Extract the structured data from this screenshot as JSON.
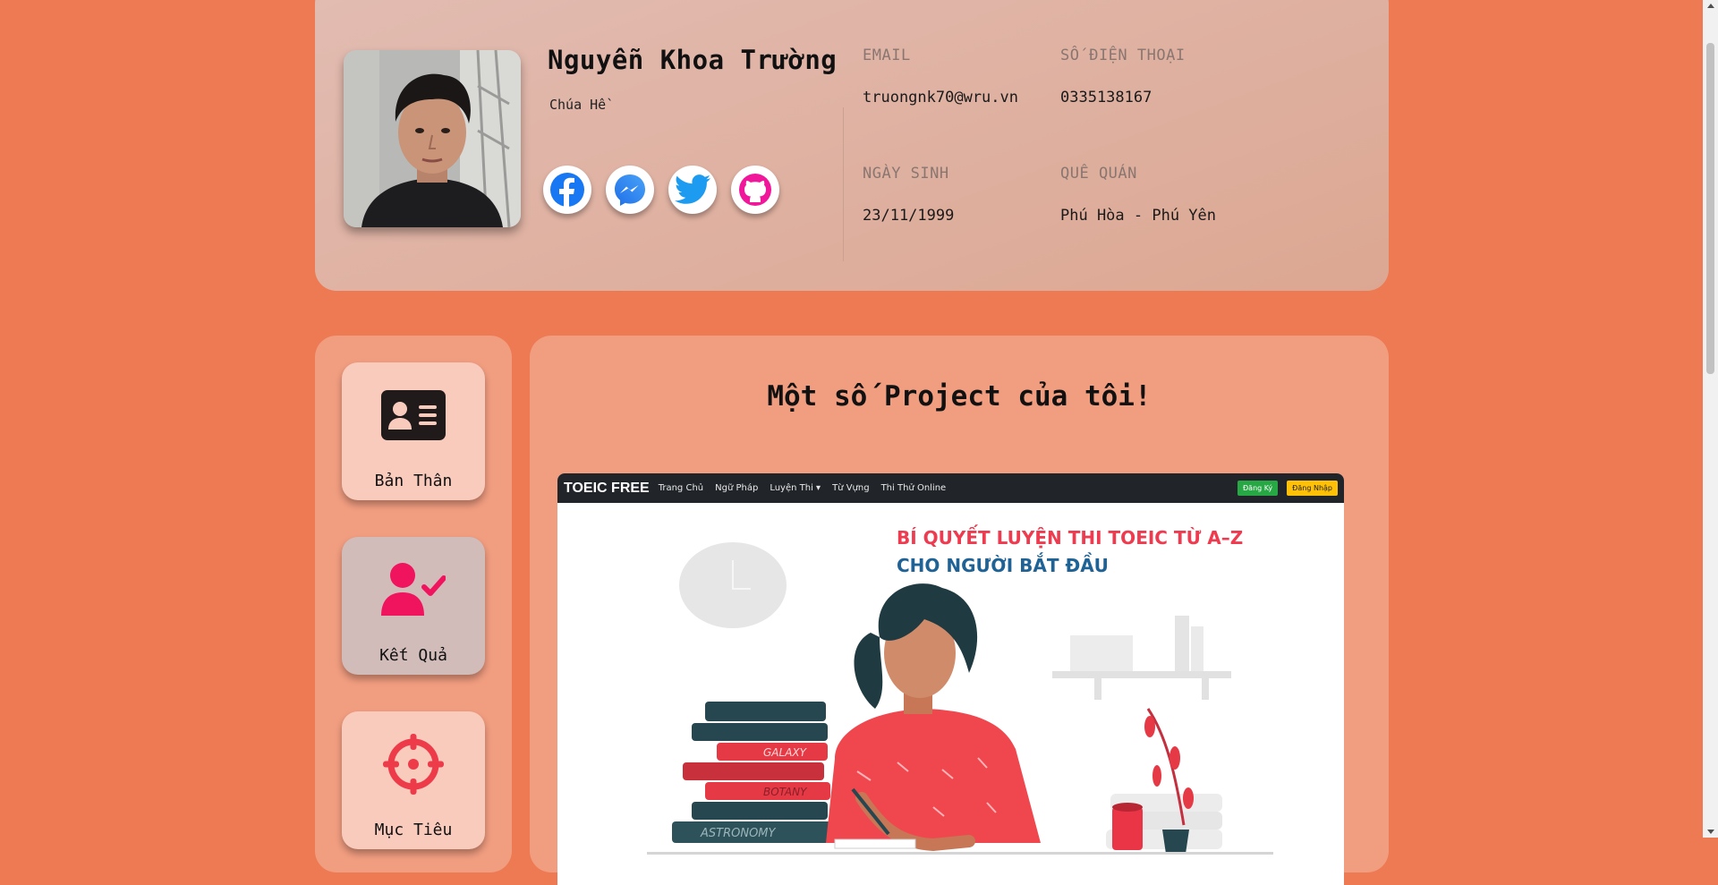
{
  "profile": {
    "name": "Nguyễn Khoa Trường",
    "subtitle": "Chúa Hề",
    "email_label": "EMAIL",
    "email": "truongnk70@wru.vn",
    "phone_label": "SỐ ĐIỆN THOẠI",
    "phone": "0335138167",
    "birthday_label": "NGÀY SINH",
    "birthday": "23/11/1999",
    "hometown_label": "QUÊ QUÁN",
    "hometown": "Phú Hòa - Phú Yên",
    "socials": [
      {
        "icon": "facebook-icon",
        "color": "#1877f2"
      },
      {
        "icon": "messenger-icon",
        "color": "#2f7bf5"
      },
      {
        "icon": "twitter-icon",
        "color": "#1d9bf0"
      },
      {
        "icon": "github-icon",
        "color": "#f0179a"
      }
    ]
  },
  "sidebar": {
    "items": [
      {
        "label": "Bản Thân",
        "icon": "id-card-icon",
        "active": false
      },
      {
        "label": "Kết Quả",
        "icon": "user-check-icon",
        "active": true
      },
      {
        "label": "Mục Tiêu",
        "icon": "crosshair-icon",
        "active": false
      }
    ]
  },
  "main": {
    "title": "Một số Project của tôi!",
    "project": {
      "brand": "TOEIC FREE",
      "nav": [
        "Trang Chủ",
        "Ngữ Pháp",
        "Luyện Thi ▾",
        "Từ Vựng",
        "Thi Thử Online"
      ],
      "register": "Đăng Ký",
      "login": "Đăng Nhập",
      "hero_line1": "BÍ QUYẾT LUYỆN THI TOEIC TỪ A–Z",
      "hero_line2": "CHO NGƯỜI BẮT ĐẦU",
      "books": [
        "GALAXY",
        "BOTANY",
        "ASTRONOMY"
      ]
    }
  },
  "colors": {
    "page_bg": "#ed7a52",
    "panel_bg": "#f19d80",
    "card_bg": "#f9cbbd",
    "active_card_bg": "#d1bcba",
    "accent_pink": "#f0145f",
    "accent_red": "#ef3b4f"
  }
}
